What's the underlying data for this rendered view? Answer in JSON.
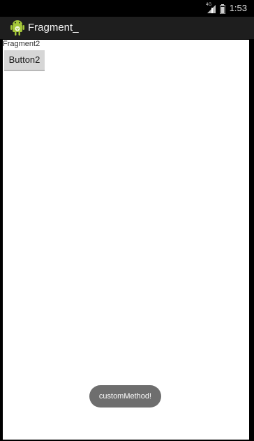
{
  "status_bar": {
    "network_type": "4G",
    "time": "1:53",
    "icons": [
      "signal-icon",
      "battery-icon"
    ]
  },
  "action_bar": {
    "app_icon": "android-icon",
    "title": "Fragment_"
  },
  "content": {
    "fragment_label": "Fragment2",
    "button_label": "Button2"
  },
  "toast": {
    "message": "customMethod!"
  },
  "colors": {
    "status_bar_bg": "#000000",
    "action_bar_bg": "#1e1e1e",
    "content_bg": "#ffffff",
    "button_bg": "#d6d6d6",
    "toast_bg": "#6e6e6e",
    "android_green": "#a4c639"
  }
}
